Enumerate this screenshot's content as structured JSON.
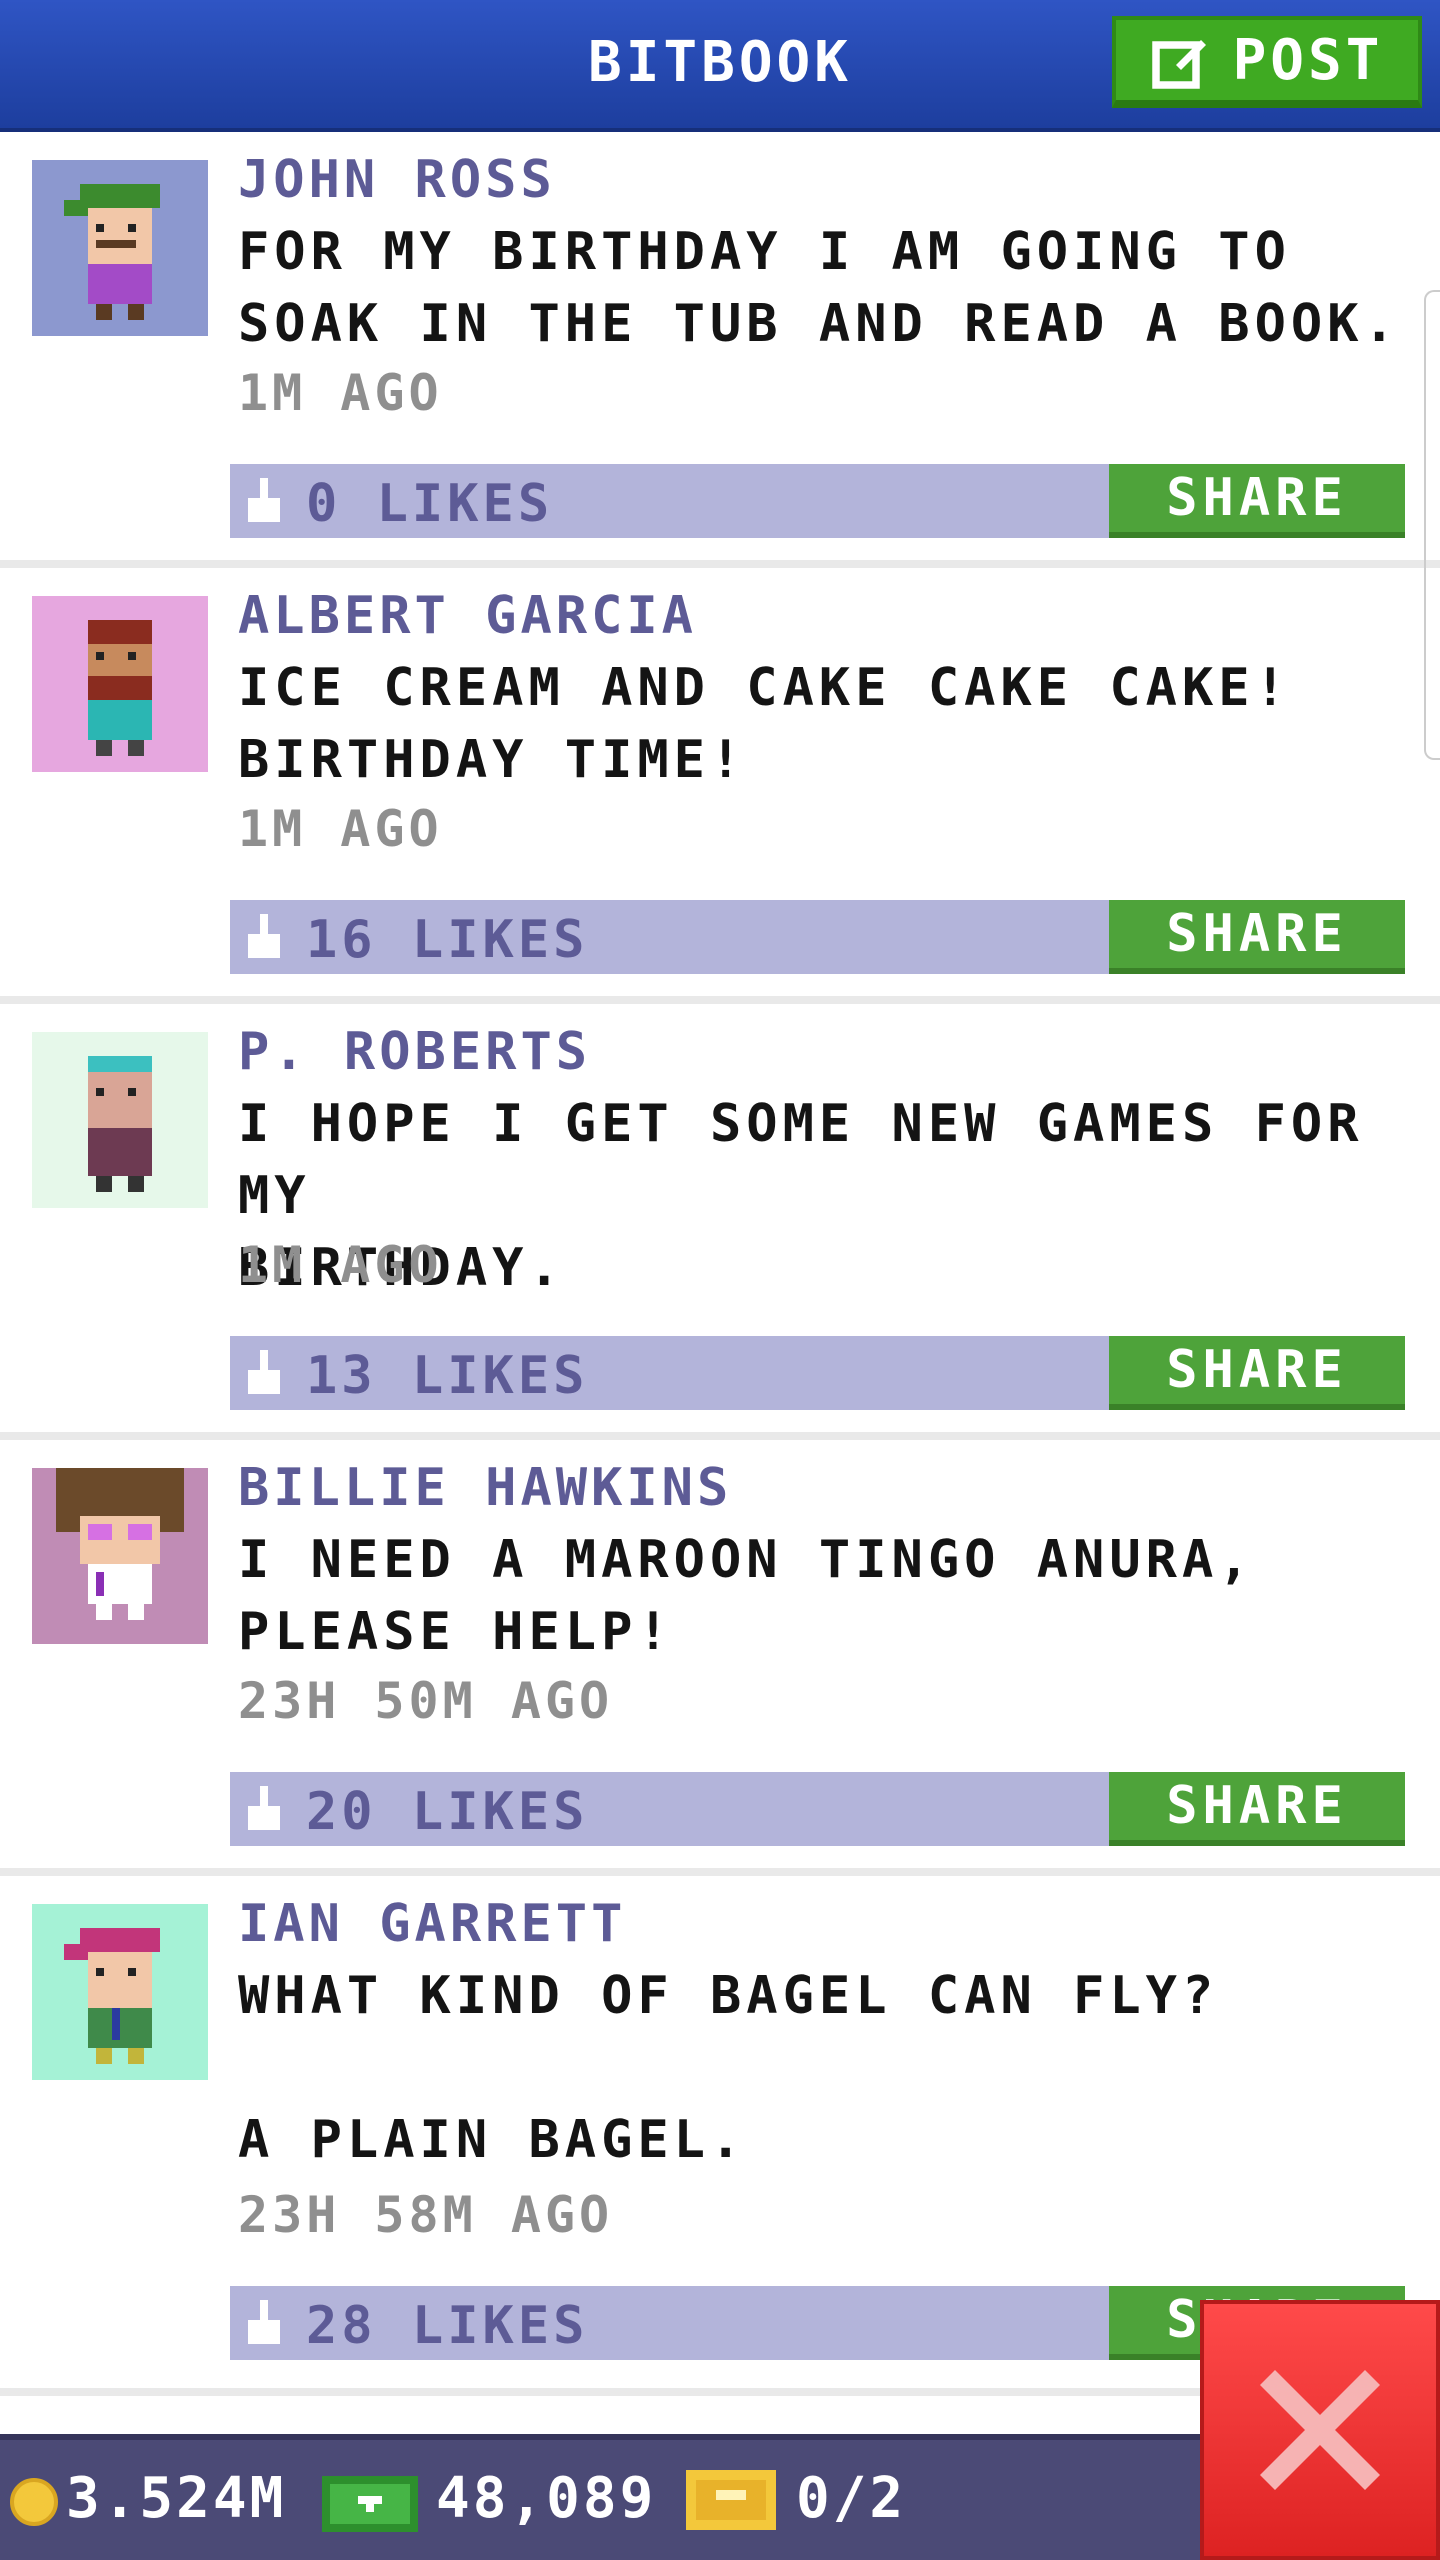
{
  "header": {
    "title": "BITBOOK",
    "post_label": "POST"
  },
  "posts": [
    {
      "author": "JOHN ROSS",
      "message": "FOR MY BIRTHDAY I AM GOING TO\nSOAK IN THE TUB AND READ A BOOK.",
      "time": "1M AGO",
      "likes": "0 LIKES",
      "share_label": "SHARE",
      "avatar_bg": "#8c98cf"
    },
    {
      "author": "ALBERT GARCIA",
      "message": "ICE CREAM AND CAKE CAKE CAKE!\nBIRTHDAY TIME!",
      "time": "1M AGO",
      "likes": "16 LIKES",
      "share_label": "SHARE",
      "avatar_bg": "#e6a7df"
    },
    {
      "author": "P. ROBERTS",
      "message": "I HOPE I GET SOME NEW GAMES FOR MY\nBIRTHDAY.",
      "time": "1M AGO",
      "likes": "13 LIKES",
      "share_label": "SHARE",
      "avatar_bg": "#e6f8ea"
    },
    {
      "author": "BILLIE HAWKINS",
      "message": "I NEED A MAROON TINGO ANURA,\nPLEASE HELP!",
      "time": "23H 50M AGO",
      "likes": "20 LIKES",
      "share_label": "SHARE",
      "avatar_bg": "#c08cb5"
    },
    {
      "author": "IAN GARRETT",
      "message": "WHAT KIND OF BAGEL CAN FLY?\n\nA PLAIN BAGEL.",
      "time": "23H 58M AGO",
      "likes": "28 LIKES",
      "share_label": "SHARE",
      "avatar_bg": "#a5f2d6"
    }
  ],
  "bottom_bar": {
    "coins": "3.524M",
    "cash": "48,089",
    "tickets": "0/2"
  },
  "colors": {
    "header": "#2f55c4",
    "accent_green": "#4ea33a",
    "like_bar": "#b3b4da",
    "name": "#5d5b96",
    "close": "#e22a2a"
  },
  "icons": {
    "post": "edit-icon",
    "like": "thumbs-up-icon",
    "coin": "coin-icon",
    "cash": "cash-icon",
    "ticket": "ticket-icon",
    "close": "close-icon"
  }
}
